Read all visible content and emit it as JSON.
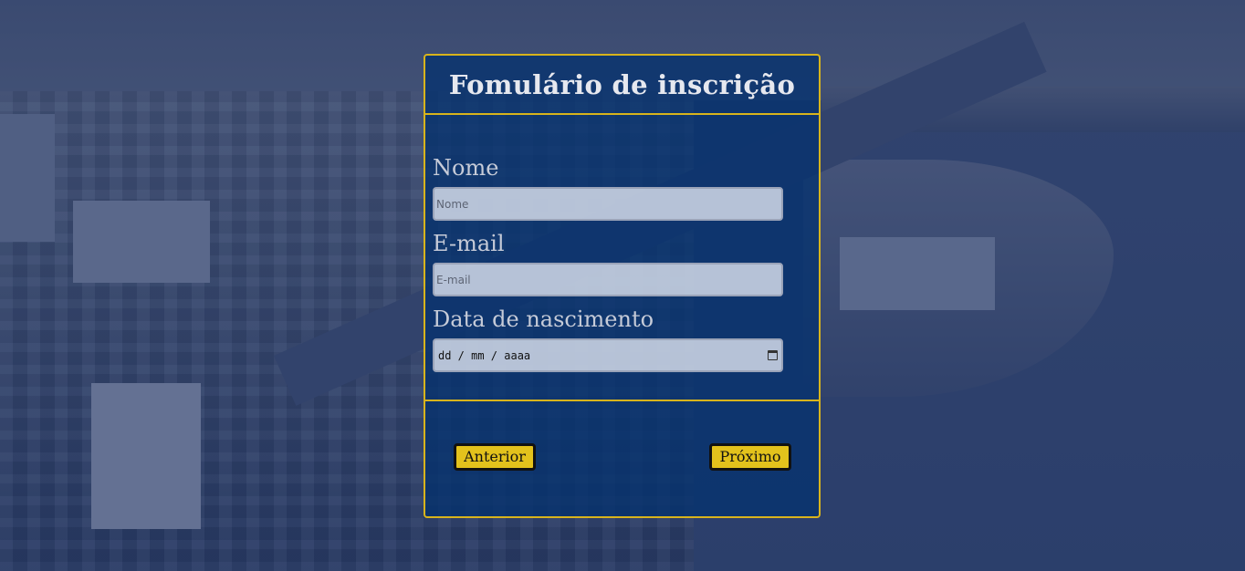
{
  "form": {
    "title": "Fomulário de inscrição",
    "fields": {
      "name": {
        "label": "Nome",
        "placeholder": "Nome"
      },
      "email": {
        "label": "E-mail",
        "placeholder": "E-mail"
      },
      "birthdate": {
        "label": "Data de nascimento",
        "placeholder": "dd / mm / aaaa",
        "icon": "calendar-icon"
      }
    },
    "buttons": {
      "previous": "Anterior",
      "next": "Próximo"
    }
  },
  "colors": {
    "accent": "#d8b41c",
    "button": "#e3c21c",
    "card": "#05326e"
  }
}
